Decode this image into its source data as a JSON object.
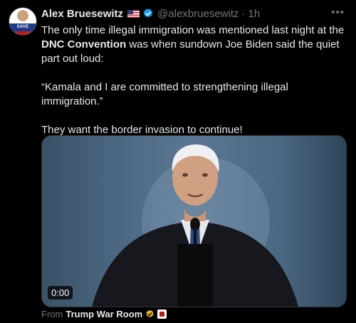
{
  "author": {
    "name": "Alex Bruesewitz",
    "handle": "@alexbruesewitz",
    "time": "1h",
    "avatar_text": "SAVE AMERICA"
  },
  "tweet": {
    "line1_before": "The only time illegal immigration was mentioned last night at the ",
    "line1_bold": "DNC Convention",
    "line1_after": " was when sundown Joe Biden said the quiet part out loud:",
    "quote": "“Kamala and I are committed to strengthening illegal immigration.”",
    "closing": "They want the border invasion to continue!"
  },
  "video": {
    "duration": "0:00"
  },
  "attribution": {
    "prefix": "From",
    "source": "Trump War Room"
  },
  "icons": {
    "more": "more-icon",
    "verified": "verified-icon",
    "flag": "us-flag-icon"
  },
  "colors": {
    "verified_blue": "#1d9bf0",
    "gold_badge": "#e2b719",
    "muted": "#71767b"
  }
}
